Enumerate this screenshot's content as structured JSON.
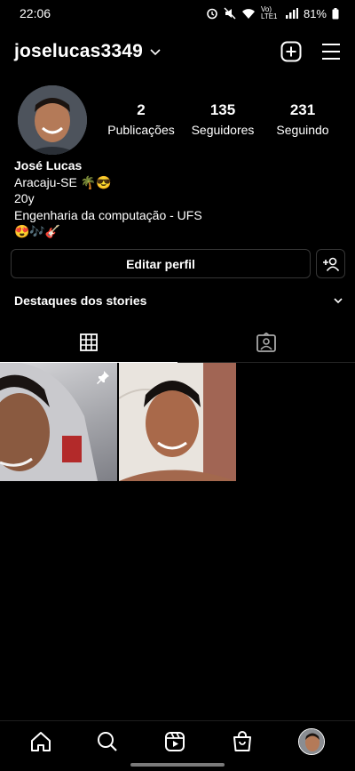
{
  "status_bar": {
    "time": "22:06",
    "battery": "81%",
    "network": "Vo) LTE1"
  },
  "header": {
    "username": "joselucas3349"
  },
  "profile": {
    "stats": [
      {
        "value": "2",
        "label": "Publicações"
      },
      {
        "value": "135",
        "label": "Seguidores"
      },
      {
        "value": "231",
        "label": "Seguindo"
      }
    ],
    "name": "José Lucas",
    "bio_lines": [
      "Aracaju-SE 🌴😎",
      "20y",
      "Engenharia da computação - UFS",
      "😍🎶🎸"
    ]
  },
  "actions": {
    "edit_profile": "Editar perfil"
  },
  "highlights": {
    "title": "Destaques dos stories"
  },
  "posts": [
    {
      "pinned": true
    },
    {
      "pinned": false
    }
  ],
  "icons": {
    "home": "home-icon",
    "search": "search-icon",
    "reels": "reels-icon",
    "shop": "shop-icon",
    "new_post": "plus-square-icon",
    "menu": "menu-icon"
  }
}
